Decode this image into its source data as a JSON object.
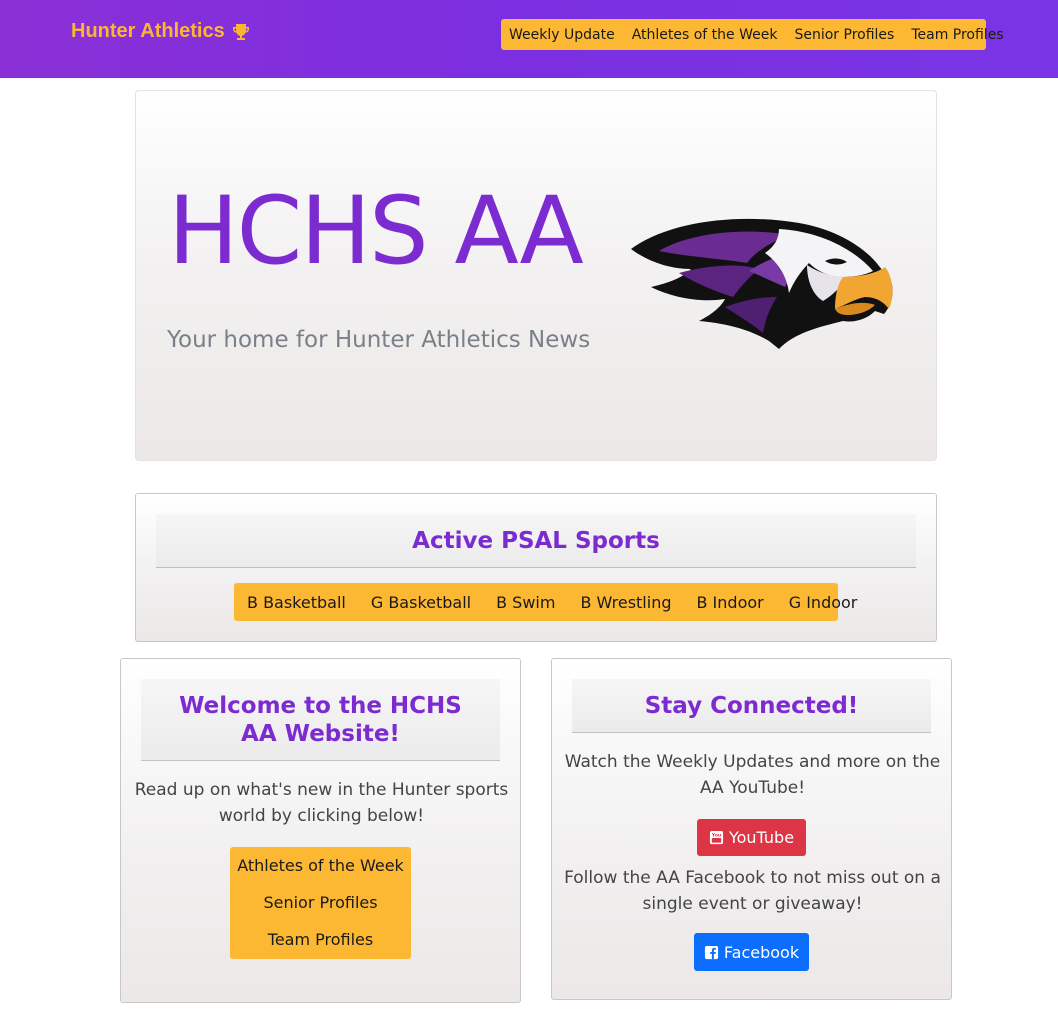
{
  "navbar": {
    "brand": "Hunter Athletics",
    "brand_icon": "trophy-icon",
    "links": [
      "Weekly Update",
      "Athletes of the Week",
      "Senior Profiles",
      "Team Profiles"
    ]
  },
  "hero": {
    "title": "HCHS AA",
    "subtitle": "Your home for Hunter Athletics News",
    "logo": "eagle-logo"
  },
  "sports": {
    "header": "Active PSAL Sports",
    "items": [
      "B Basketball",
      "G Basketball",
      "B Swim",
      "B Wrestling",
      "B Indoor",
      "G Indoor"
    ]
  },
  "welcome": {
    "header": "Welcome to the HCHS AA Website!",
    "text": "Read up on what's new in the Hunter sports world by clicking below!",
    "links": [
      "Athletes of the Week",
      "Senior Profiles",
      "Team Profiles"
    ]
  },
  "connect": {
    "header": "Stay Connected!",
    "youtube_text": "Watch the Weekly Updates and more on the AA YouTube!",
    "youtube_label": "YouTube",
    "facebook_text": "Follow the AA Facebook to not miss out on a single event or giveaway!",
    "facebook_label": "Facebook"
  },
  "colors": {
    "purple": "#7c2bd0",
    "gold": "#fdb833",
    "youtube_red": "#dc3545",
    "facebook_blue": "#0d6efd"
  }
}
